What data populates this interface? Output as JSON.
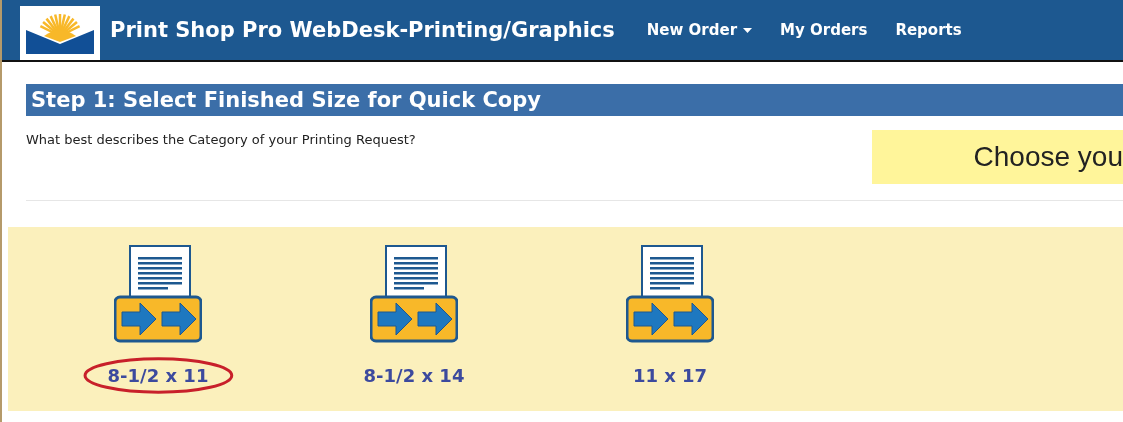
{
  "header": {
    "title": "Print Shop Pro WebDesk-Printing/Graphics",
    "nav": [
      {
        "label": "New Order",
        "kind": "dropdown"
      },
      {
        "label": "My Orders",
        "kind": "link"
      },
      {
        "label": "Reports",
        "kind": "link"
      }
    ]
  },
  "step": {
    "title": "Step 1: Select Finished Size for Quick Copy",
    "question": "What best describes the Category of your Printing Request?",
    "callout": "Choose you"
  },
  "sizes": [
    {
      "label": "8-1/2 x 11",
      "selected": true
    },
    {
      "label": "8-1/2 x 14",
      "selected": false
    },
    {
      "label": "11 x 17",
      "selected": false
    }
  ]
}
